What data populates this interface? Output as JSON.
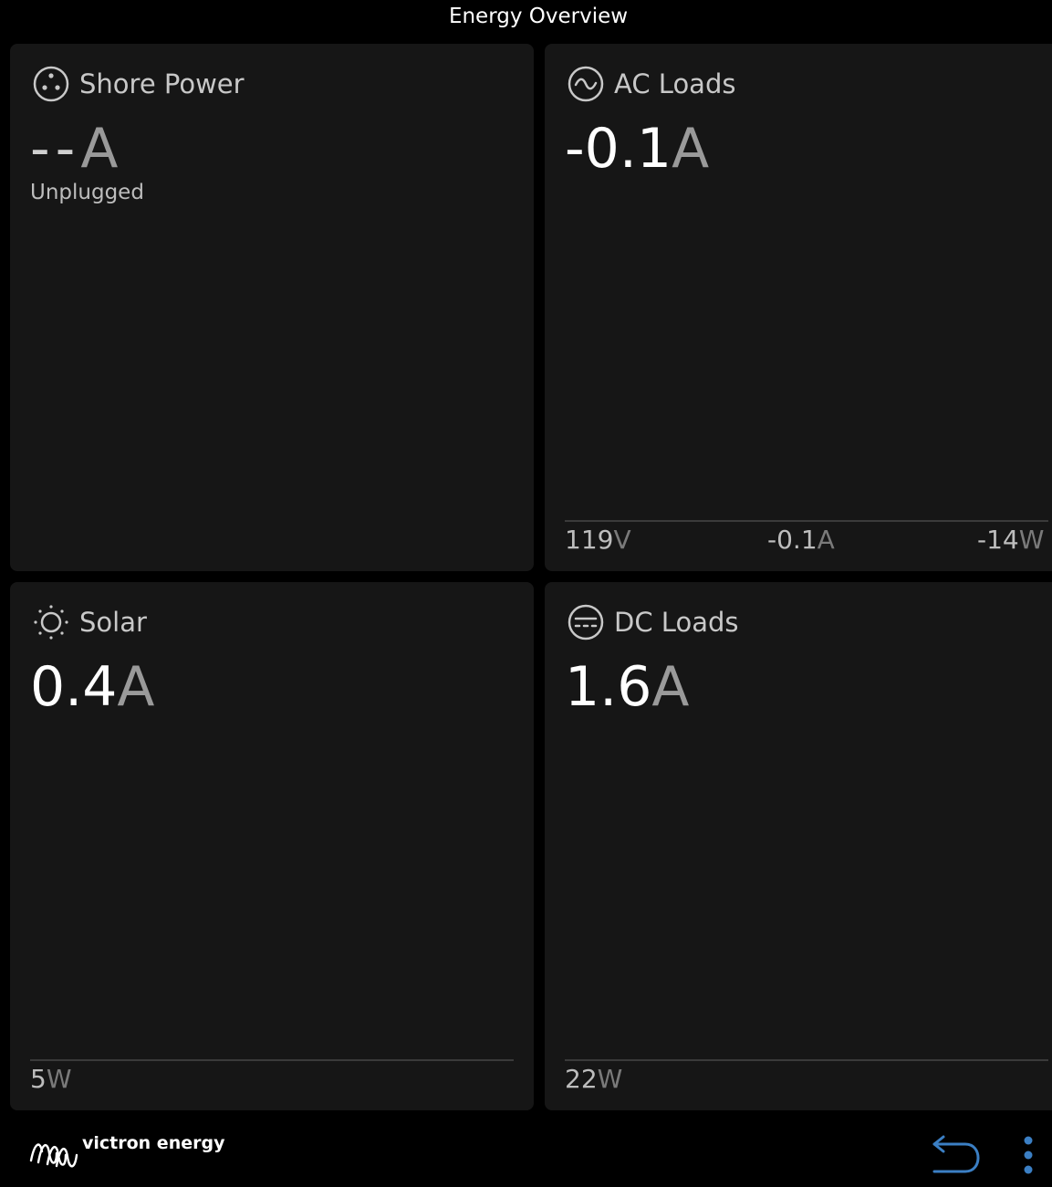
{
  "header": {
    "title": "Energy Overview"
  },
  "tiles": {
    "shore_power": {
      "title": "Shore Power",
      "value": "--",
      "unit": "A",
      "status": "Unplugged",
      "icon": "shore-power-icon"
    },
    "ac_loads": {
      "title": "AC Loads",
      "value": "-0.1",
      "unit": "A",
      "icon": "ac-wave-icon",
      "stats": {
        "voltage": "119",
        "voltage_unit": "V",
        "current": "-0.1",
        "current_unit": "A",
        "power": "-14",
        "power_unit": "W"
      }
    },
    "solar": {
      "title": "Solar",
      "value": "0.4",
      "unit": "A",
      "icon": "sun-icon",
      "stats": {
        "power": "5",
        "power_unit": "W"
      }
    },
    "dc_loads": {
      "title": "DC Loads",
      "value": "1.6",
      "unit": "A",
      "icon": "dc-icon",
      "stats": {
        "power": "22",
        "power_unit": "W"
      }
    }
  },
  "footer": {
    "logo_text": "victron energy",
    "back_icon": "back-arrow-icon",
    "menu_icon": "more-vertical-icon",
    "accent_color": "#3b7fc4"
  }
}
